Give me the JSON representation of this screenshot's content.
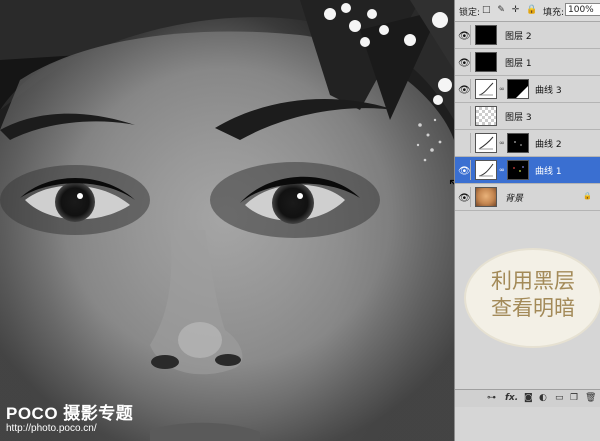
{
  "photo": {
    "watermark_brand": "POCO 摄影专题",
    "watermark_url": "http://photo.poco.cn/"
  },
  "layers_panel": {
    "lock_label": "锁定:",
    "lock_icons": "□ ✎ ✛ 🔒",
    "fill_label": "填充:",
    "fill_value": "100%",
    "layers": [
      {
        "name": "图层 2",
        "visible": true,
        "thumb": "black",
        "selected": false
      },
      {
        "name": "图层 1",
        "visible": true,
        "thumb": "black",
        "selected": false
      },
      {
        "name": "曲线 3",
        "visible": true,
        "thumb": "curves",
        "mask": true,
        "selected": false
      },
      {
        "name": "图层 3",
        "visible": false,
        "thumb": "transparent",
        "selected": false
      },
      {
        "name": "曲线 2",
        "visible": false,
        "thumb": "curves",
        "mask": true,
        "selected": false
      },
      {
        "name": "曲线 1",
        "visible": true,
        "thumb": "curves",
        "mask": true,
        "selected": true
      },
      {
        "name": "背景",
        "visible": true,
        "thumb": "portrait",
        "selected": false
      }
    ],
    "bottom_icons": [
      "link-icon",
      "fx-icon",
      "mask-icon",
      "adjustment-icon",
      "folder-icon",
      "new-layer-icon",
      "trash-icon"
    ],
    "bottom_fx": "fx."
  },
  "callout": {
    "line1": "利用黑层",
    "line2": "查看明暗"
  },
  "colors": {
    "selection": "#3a6fd1",
    "callout_text": "#a38a58"
  }
}
